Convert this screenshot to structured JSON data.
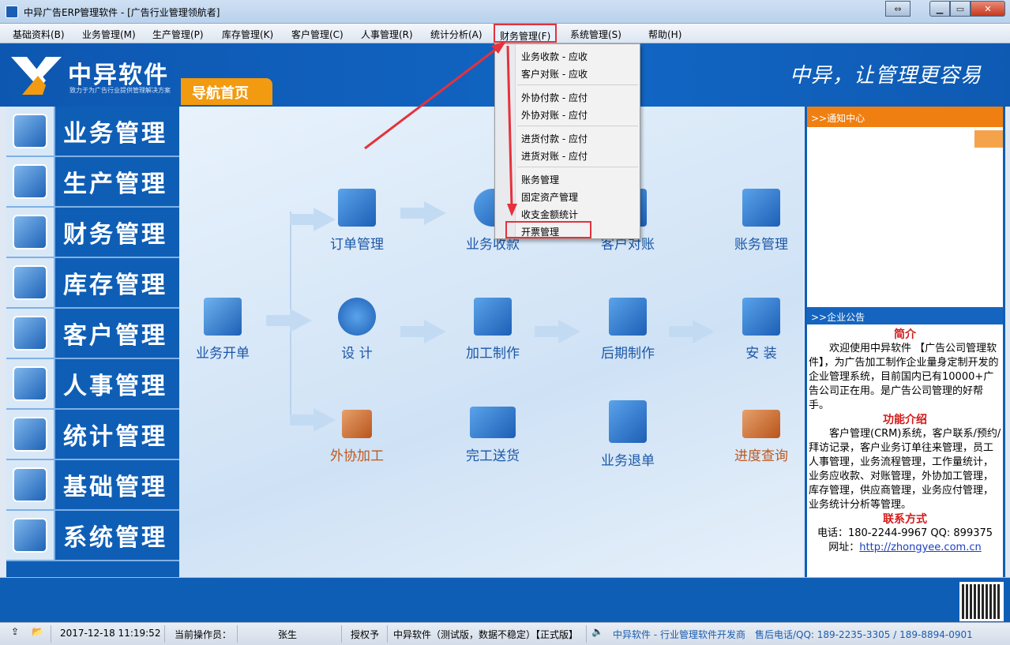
{
  "window": {
    "title": "中异广告ERP管理软件 - [广告行业管理领航者]"
  },
  "menu": [
    "基础资料(B)",
    "业务管理(M)",
    "生产管理(P)",
    "库存管理(K)",
    "客户管理(C)",
    "人事管理(R)",
    "统计分析(A)",
    "财务管理(F)",
    "系统管理(S)",
    "帮助(H)"
  ],
  "banner": {
    "brand": "中异软件",
    "tagline": "致力于为广告行业提供管理解决方案",
    "nav_tab": "导航首页",
    "slogan": "中异，让管理更容易"
  },
  "sidebar": [
    "业务管理",
    "生产管理",
    "财务管理",
    "库存管理",
    "客户管理",
    "人事管理",
    "统计管理",
    "基础管理",
    "系统管理"
  ],
  "flow": {
    "order": "订单管理",
    "receipt": "业务收款",
    "reconcile": "客户对账",
    "accounts": "账务管理",
    "new_order": "业务开单",
    "design": "设  计",
    "production": "加工制作",
    "post": "后期制作",
    "install": "安 装",
    "outsource": "外协加工",
    "delivery": "完工送货",
    "return": "业务退单",
    "progress": "进度查询"
  },
  "dropdown": [
    "业务收款  -  应收",
    "客户对账  -  应收",
    "外协付款  -  应付",
    "外协对账  -  应付",
    "进货付款  -  应付",
    "进货对账  -  应付",
    "账务管理",
    "固定资产管理",
    "收支金额统计",
    "开票管理"
  ],
  "right_panel": {
    "notice_title": ">>通知中心",
    "announce_title": ">>企业公告",
    "intro_h": "简介",
    "intro": "欢迎使用中异软件 【广告公司管理软件】，为广告加工制作企业量身定制开发的企业管理系统，目前国内已有10000+广告公司正在用。是广告公司管理的好帮手。",
    "func_h": "功能介绍",
    "func": "客户管理(CRM)系统，客户联系/预约/拜访记录，客户业务订单往来管理，员工人事管理，业务流程管理，工作量统计，业务应收款、对账管理，外协加工管理，库存管理，供应商管理，业务应付管理，业务统计分析等管理。",
    "contact_h": "联系方式",
    "phone": "电话：180-2244-9967  QQ: 899375",
    "site_label": "网址：",
    "site": "http://zhongyee.com.cn"
  },
  "status": {
    "datetime": "2017-12-18 11:19:52",
    "operator_label": "当前操作员：",
    "operator": "张生",
    "auth": "授权予",
    "version": "中异软件（测试版，数据不稳定）【正式版】",
    "company": "中异软件 - 行业管理软件开发商",
    "support": "售后电话/QQ: 189-2235-3305 / 189-8894-0901"
  }
}
